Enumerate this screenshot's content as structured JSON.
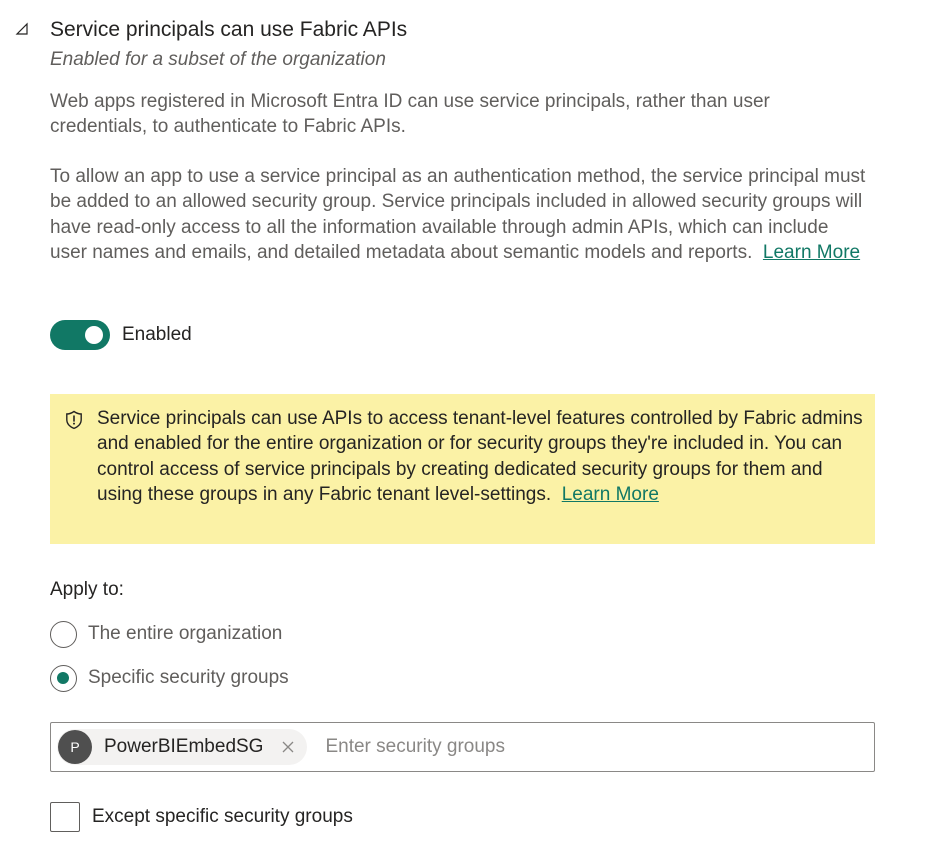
{
  "setting": {
    "collapse_icon": "triangle-collapse-icon",
    "title": "Service principals can use Fabric APIs",
    "subtitle": "Enabled for a subset of the organization",
    "description_1": "Web apps registered in Microsoft Entra ID can use service principals, rather than user credentials, to authenticate to Fabric APIs.",
    "description_2": "To allow an app to use a service principal as an authentication method, the service principal must be added to an allowed security group. Service principals included in allowed security groups will have read-only access to all the information available through admin APIs, which can include user names and emails, and detailed metadata about semantic models and reports.",
    "description_2_link": "Learn More"
  },
  "toggle": {
    "state": "on",
    "label": "Enabled"
  },
  "warning": {
    "icon": "shield-icon",
    "text": "Service principals can use APIs to access tenant-level features controlled by Fabric admins and enabled for the entire organization or for security groups they're included in. You can control access of service principals by creating dedicated security groups for them and using these groups in any Fabric tenant level-settings.",
    "link": "Learn More"
  },
  "apply_to": {
    "label": "Apply to:",
    "options": [
      {
        "label": "The entire organization",
        "selected": false
      },
      {
        "label": "Specific security groups",
        "selected": true
      }
    ]
  },
  "security_groups": {
    "chips": [
      {
        "initial": "P",
        "label": "PowerBIEmbedSG"
      }
    ],
    "placeholder": "Enter security groups"
  },
  "except": {
    "label": "Except specific security groups",
    "checked": false
  },
  "colors": {
    "accent": "#117865",
    "warning_bg": "#fbf2a6",
    "text_primary": "#252423",
    "text_secondary": "#605e5c"
  }
}
